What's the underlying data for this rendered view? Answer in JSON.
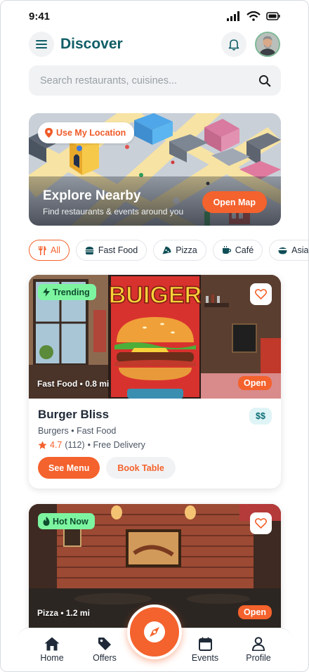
{
  "status": {
    "time": "9:41"
  },
  "header": {
    "title": "Discover"
  },
  "search": {
    "placeholder": "Search restaurants, cuisines..."
  },
  "map_card": {
    "location_label": "Use My Location",
    "title": "Explore Nearby",
    "subtitle": "Find restaurants & events around you",
    "button": "Open Map"
  },
  "chips": [
    {
      "label": "All",
      "icon": "utensils-icon",
      "active": true
    },
    {
      "label": "Fast Food",
      "icon": "burger-icon"
    },
    {
      "label": "Pizza",
      "icon": "pizza-icon"
    },
    {
      "label": "Café",
      "icon": "coffee-icon"
    },
    {
      "label": "Asian",
      "icon": "bowl-icon"
    }
  ],
  "restaurants": [
    {
      "badge": "Trending",
      "badge_icon": "bolt-icon",
      "meta": "Fast Food • 0.8 mi",
      "status": "Open",
      "name": "Burger Bliss",
      "cuisine": "Burgers • Fast Food",
      "rating": "4.7",
      "reviews": "(112)",
      "delivery": "• Free Delivery",
      "price": "$$",
      "sign_text": "BUIGER",
      "primary_action": "See Menu",
      "secondary_action": "Book Table"
    },
    {
      "badge": "Hot Now",
      "badge_icon": "flame-icon",
      "meta": "Pizza • 1.2 mi",
      "status": "Open"
    }
  ],
  "nav": {
    "home": "Home",
    "offers": "Offers",
    "events": "Events",
    "profile": "Profile"
  },
  "colors": {
    "accent": "#f4622d",
    "title": "#0f5e66",
    "badge": "#7df5a0"
  }
}
